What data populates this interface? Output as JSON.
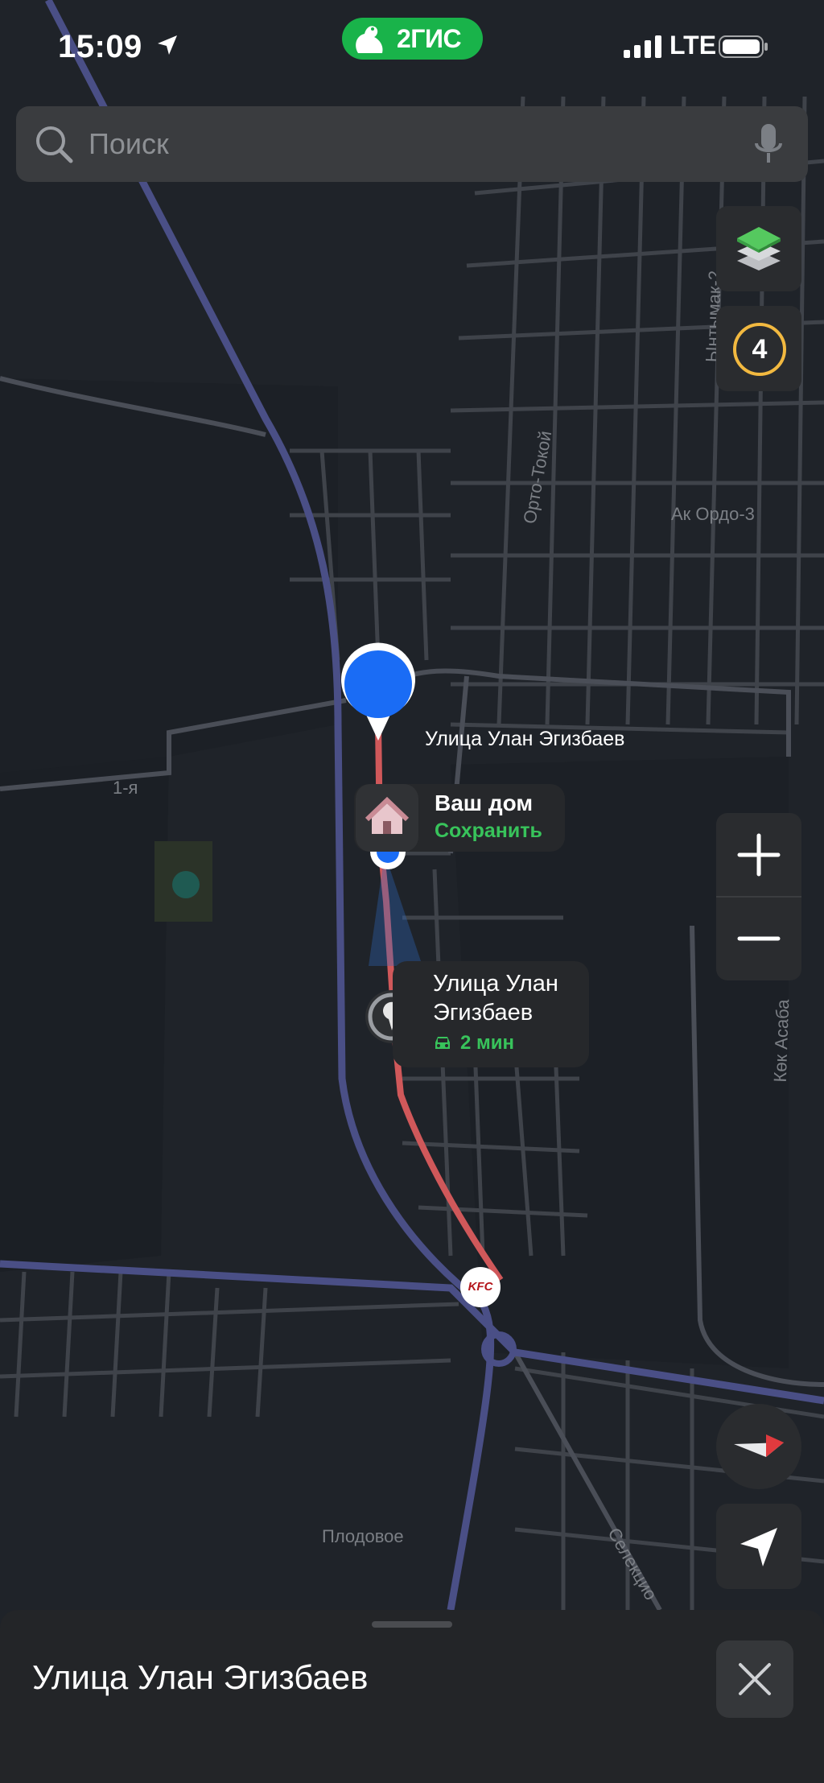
{
  "status_bar": {
    "time": "15:09",
    "network": "LTE",
    "brand": "2ГИС"
  },
  "search": {
    "placeholder": "Поиск"
  },
  "map": {
    "traffic_level": "4",
    "streets": {
      "ulan_egizbaev": "Улица Улан Эгизбаев",
      "orto_tokoy": "Орто-Токой",
      "ak_ordo": "Ак Ордо-3",
      "yntymak": "Ынтымак-2",
      "kok_asaba": "Көк Асаба",
      "first": "1-я",
      "plodovoe": "Плодовое",
      "selektsionnaya": "Селекцио"
    },
    "home_card": {
      "title": "Ваш дом",
      "action": "Сохранить"
    },
    "destination_card": {
      "title": "Улица Улан Эгизбаев",
      "eta": "2 мин"
    },
    "kfc_label": "KFC"
  },
  "bottom_sheet": {
    "title": "Улица Улан Эгизбаев"
  },
  "colors": {
    "accent_green": "#38c35b",
    "route_red": "#d9534f",
    "pin_blue": "#1a6cf5",
    "map_bg": "#1f2329"
  }
}
